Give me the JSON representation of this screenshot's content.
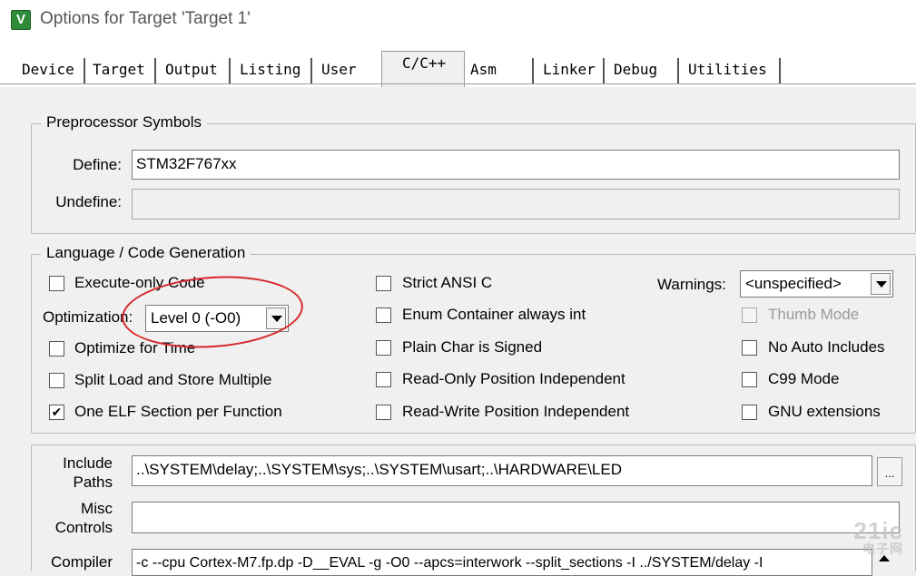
{
  "window": {
    "title": "Options for Target 'Target 1'",
    "icon": "keil-uvision-icon"
  },
  "tabs": [
    {
      "label": "Device"
    },
    {
      "label": "Target"
    },
    {
      "label": "Output"
    },
    {
      "label": "Listing"
    },
    {
      "label": "User"
    },
    {
      "label": "C/C++"
    },
    {
      "label": "Asm"
    },
    {
      "label": "Linker"
    },
    {
      "label": "Debug"
    },
    {
      "label": "Utilities"
    }
  ],
  "active_tab": "C/C++",
  "preprocessor": {
    "legend": "Preprocessor Symbols",
    "define_label": "Define:",
    "define_value": "STM32F767xx",
    "undefine_label": "Undefine:",
    "undefine_value": ""
  },
  "language": {
    "legend": "Language / Code Generation",
    "execute_only": "Execute-only Code",
    "optimization_label": "Optimization:",
    "optimization_value": "Level 0 (-O0)",
    "optimize_time": "Optimize for Time",
    "split_load": "Split Load and Store Multiple",
    "one_elf": "One ELF Section per Function",
    "strict_ansi": "Strict ANSI C",
    "enum_container": "Enum Container always int",
    "plain_char": "Plain Char is Signed",
    "ropi": "Read-Only Position Independent",
    "rwpi": "Read-Write Position Independent",
    "warnings_label": "Warnings:",
    "warnings_value": "<unspecified>",
    "thumb_mode": "Thumb Mode",
    "no_auto_includes": "No Auto Includes",
    "c99_mode": "C99 Mode",
    "gnu_ext": "GNU extensions",
    "check_mark": "✔"
  },
  "paths": {
    "include_label_1": "Include",
    "include_label_2": "Paths",
    "include_value": "..\\SYSTEM\\delay;..\\SYSTEM\\sys;..\\SYSTEM\\usart;..\\HARDWARE\\LED",
    "browse_label": "...",
    "misc_label_1": "Misc",
    "misc_label_2": "Controls",
    "misc_value": "",
    "compiler_label": "Compiler",
    "compiler_value": "-c --cpu Cortex-M7.fp.dp -D__EVAL -g -O0 --apcs=interwork --split_sections -I ../SYSTEM/delay -I"
  },
  "watermark": {
    "main": "21ic",
    "sub": "电子网"
  },
  "colors": {
    "annotation": "#d7262a",
    "icon": "#2e8b3a"
  }
}
